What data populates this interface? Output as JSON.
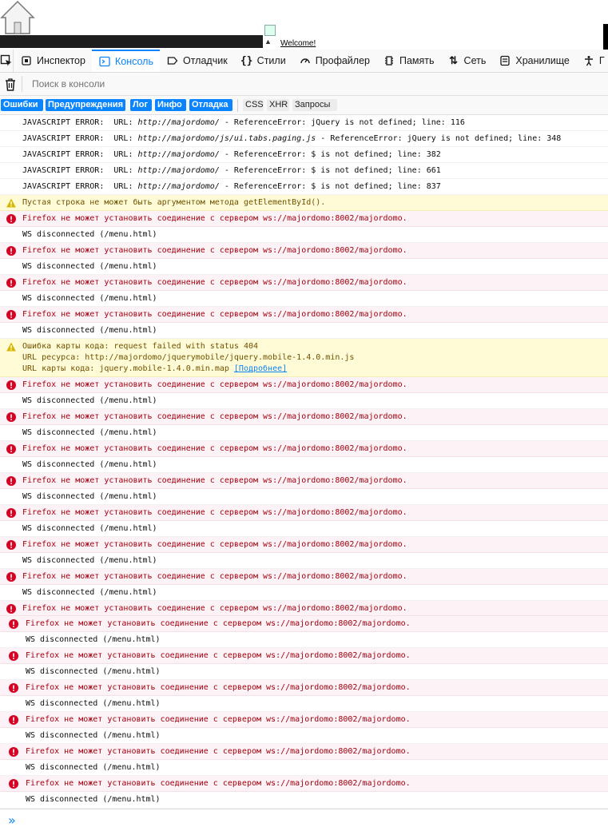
{
  "page": {
    "welcome": "Welcome!"
  },
  "tabs": [
    {
      "label": "Инспектор",
      "icon": "inspector-icon"
    },
    {
      "label": "Консоль",
      "icon": "console-icon"
    },
    {
      "label": "Отладчик",
      "icon": "debugger-icon"
    },
    {
      "label": "Стили",
      "icon": "style-editor-icon"
    },
    {
      "label": "Профайлер",
      "icon": "profiler-icon"
    },
    {
      "label": "Память",
      "icon": "memory-icon"
    },
    {
      "label": "Сеть",
      "icon": "network-icon"
    },
    {
      "label": "Хранилище",
      "icon": "storage-icon"
    },
    {
      "label": "Г",
      "icon": "accessibility-icon"
    }
  ],
  "toolbar": {
    "filter_placeholder": "Поиск в консоли"
  },
  "filters": {
    "errors": "Ошибки",
    "warnings": "Предупреждения",
    "logs": "Лог",
    "info": "Инфо",
    "debug": "Отладка",
    "css": "CSS",
    "xhr": "XHR",
    "requests": "Запросы"
  },
  "messages": {
    "js1_prefix": "JAVASCRIPT ERROR:  URL: ",
    "js1_url": "http://majordomo/",
    "js1_rest": " - ReferenceError: jQuery is not defined; line: 116",
    "js2_prefix": "JAVASCRIPT ERROR:  URL: ",
    "js2_url": "http://majordomo/js/ui.tabs.paging.js",
    "js2_rest": " - ReferenceError: jQuery is not defined; line: 348",
    "js3_prefix": "JAVASCRIPT ERROR:  URL: ",
    "js3_url": "http://majordomo/",
    "js3_rest": " - ReferenceError: $ is not defined; line: 382",
    "js4_prefix": "JAVASCRIPT ERROR:  URL: ",
    "js4_url": "http://majordomo/",
    "js4_rest": " - ReferenceError: $ is not defined; line: 661",
    "js5_prefix": "JAVASCRIPT ERROR:  URL: ",
    "js5_url": "http://majordomo/",
    "js5_rest": " - ReferenceError: $ is not defined; line: 837",
    "warn_empty": "Пустая строка не может быть аргументом метода getElementById().",
    "ws_error": "Firefox не может установить соединение с сервером ws://majordomo:8002/majordomo.",
    "ws_disconnected": "WS disconnected (/menu.html)",
    "sourcemap_line1": "Ошибка карты кода: request failed with status 404",
    "sourcemap_line2": "URL ресурса: http://majordomo/jquerymobile/jquery.mobile-1.4.0.min.js",
    "sourcemap_line3_prefix": "URL карты кода: jquery.mobile-1.4.0.min.map ",
    "sourcemap_more": "[Подробнее]"
  },
  "prompt": "»"
}
